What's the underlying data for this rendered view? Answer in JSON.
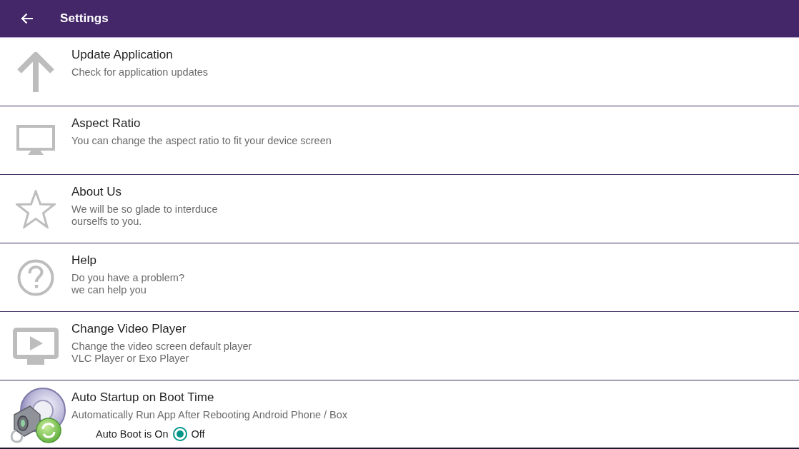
{
  "app_bar": {
    "title": "Settings"
  },
  "settings": [
    {
      "kind": "update",
      "title": "Update Application",
      "description": [
        "Check for application updates"
      ]
    },
    {
      "kind": "display",
      "title": "Aspect Ratio",
      "description": [
        "You can change the aspect ratio to fit your device screen"
      ]
    },
    {
      "kind": "about",
      "title": "About Us",
      "description": [
        "We will be so glade to interduce",
        "ourselfs to you."
      ]
    },
    {
      "kind": "help",
      "title": "Help",
      "description": [
        "Do you have a problem?",
        "we can help you"
      ]
    },
    {
      "kind": "player",
      "title": "Change Video Player",
      "description": [
        "Change the video screen default player",
        "VLC Player or Exo Player"
      ]
    },
    {
      "kind": "startup",
      "title": "Auto Startup on Boot Time",
      "description": [
        "Automatically Run App After Rebooting Android Phone / Box"
      ],
      "auto_boot": {
        "status": "Auto Boot is On",
        "option": {
          "label": "Off",
          "selected": true
        }
      }
    }
  ]
}
